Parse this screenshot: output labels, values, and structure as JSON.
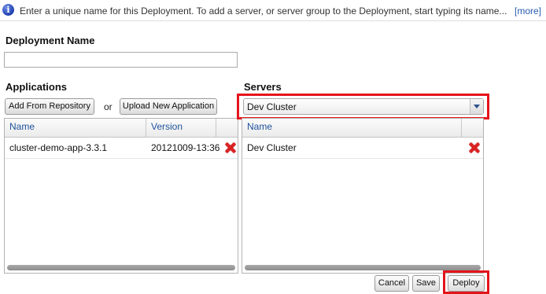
{
  "info": {
    "icon": "info-icon",
    "message": "Enter a unique name for this Deployment. To add a server, or server group to the Deployment, start typing its name...",
    "more_link": "[more]"
  },
  "deployment": {
    "name_label": "Deployment Name",
    "name_value": ""
  },
  "applications": {
    "label": "Applications",
    "add_from_repository": "Add From Repository",
    "or_text": "or",
    "upload_new": "Upload New Application",
    "columns": [
      "Name",
      "Version"
    ],
    "rows": [
      {
        "name": "cluster-demo-app-3.3.1",
        "version": "20121009-13:36",
        "remove_icon": "delete-x-icon"
      }
    ]
  },
  "servers": {
    "label": "Servers",
    "selected": "Dev Cluster",
    "columns": [
      "Name"
    ],
    "rows": [
      {
        "name": "Dev Cluster",
        "remove_icon": "delete-x-icon"
      }
    ]
  },
  "actions": {
    "cancel": "Cancel",
    "save": "Save",
    "deploy": "Deploy"
  },
  "highlight_color": "#e4141b",
  "link_color": "#2a5db0"
}
